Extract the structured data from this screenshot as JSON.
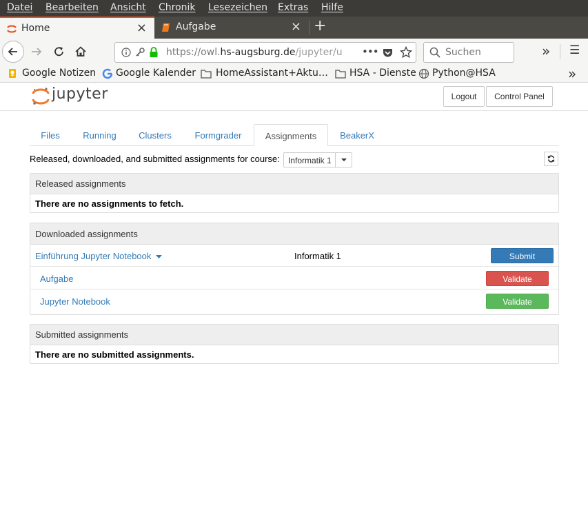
{
  "menu": [
    "Datei",
    "Bearbeiten",
    "Ansicht",
    "Chronik",
    "Lesezeichen",
    "Extras",
    "Hilfe"
  ],
  "browser_tabs": [
    {
      "label": "Home",
      "close": "×"
    },
    {
      "label": "Aufgabe",
      "close": "×"
    }
  ],
  "new_tab": "+",
  "url": {
    "prefix": "https://owl.",
    "domain": "hs-augsburg.de",
    "path": "/jupyter/u",
    "actions": "•••"
  },
  "search": {
    "placeholder": "Suchen"
  },
  "overflow": "»",
  "menu_icon": "☰",
  "bookmarks": [
    "Google Notizen",
    "Google Kalender",
    "HomeAssistant+Aktu…",
    "HSA - Dienste",
    "Python@HSA"
  ],
  "jupyter": {
    "logo": "jupyter",
    "logout": "Logout",
    "control_panel": "Control Panel",
    "tabs": [
      "Files",
      "Running",
      "Clusters",
      "Formgrader",
      "Assignments",
      "BeakerX"
    ],
    "active_tab": "Assignments",
    "course_label": "Released, downloaded, and submitted assignments for course:",
    "course_selected": "Informatik 1",
    "released": {
      "title": "Released assignments",
      "message": "There are no assignments to fetch."
    },
    "downloaded": {
      "title": "Downloaded assignments",
      "assignment": "Einführung Jupyter Notebook",
      "course": "Informatik 1",
      "submit": "Submit",
      "notebooks": [
        {
          "name": "Aufgabe",
          "action": "Validate",
          "color": "#d9534f"
        },
        {
          "name": "Jupyter Notebook",
          "action": "Validate",
          "color": "#5cb85c"
        }
      ]
    },
    "submitted": {
      "title": "Submitted assignments",
      "message": "There are no submitted assignments."
    }
  },
  "colors": {
    "accent": "#e95420",
    "primary": "#337ab7",
    "danger": "#d9534f",
    "success": "#5cb85c"
  }
}
